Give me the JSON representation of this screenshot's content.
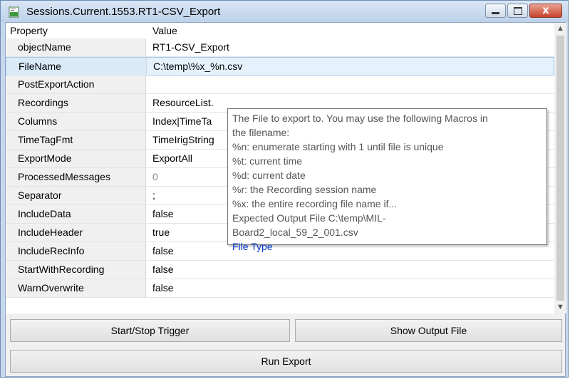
{
  "window": {
    "title": "Sessions.Current.1553.RT1-CSV_Export",
    "close_glyph": "x",
    "icons": [
      "csv-file-icon",
      "minimize-icon",
      "maximize-icon",
      "close-icon"
    ]
  },
  "grid": {
    "headers": {
      "property": "Property",
      "value": "Value"
    },
    "rows": [
      {
        "name": "objectName",
        "value": "RT1-CSV_Export"
      },
      {
        "name": "FileName",
        "value": "C:\\temp\\%x_%n.csv",
        "selected": true
      },
      {
        "name": "PostExportAction",
        "value": ""
      },
      {
        "name": "Recordings",
        "value": "ResourceList."
      },
      {
        "name": "Columns",
        "value": "Index|TimeTa"
      },
      {
        "name": "TimeTagFmt",
        "value": "TimeIrigString"
      },
      {
        "name": "ExportMode",
        "value": "ExportAll"
      },
      {
        "name": "ProcessedMessages",
        "value": "0",
        "muted": true
      },
      {
        "name": "Separator",
        "value": ";"
      },
      {
        "name": "IncludeData",
        "value": "false"
      },
      {
        "name": "IncludeHeader",
        "value": "true"
      },
      {
        "name": "IncludeRecInfo",
        "value": "false"
      },
      {
        "name": "StartWithRecording",
        "value": "false"
      },
      {
        "name": "WarnOverwrite",
        "value": "false"
      }
    ]
  },
  "tooltip": {
    "lines": [
      "The File to export to. You may use the following Macros in",
      "the filename:",
      "%n: enumerate starting with 1 until file is unique",
      "%t: current time",
      "%d: current date",
      "%r: the Recording session name",
      "%x: the entire recording file name if...",
      "Expected Output File C:\\temp\\MIL-",
      "Board2_local_59_2_001.csv"
    ],
    "link": "File Type"
  },
  "buttons": {
    "trigger": "Start/Stop Trigger",
    "show_output": "Show Output File",
    "run_export": "Run Export"
  },
  "colors": {
    "selected_row": "#e5f1fb",
    "link": "#0033cc",
    "titlebar": "#c7d8ec",
    "close_button": "#c7432c"
  }
}
